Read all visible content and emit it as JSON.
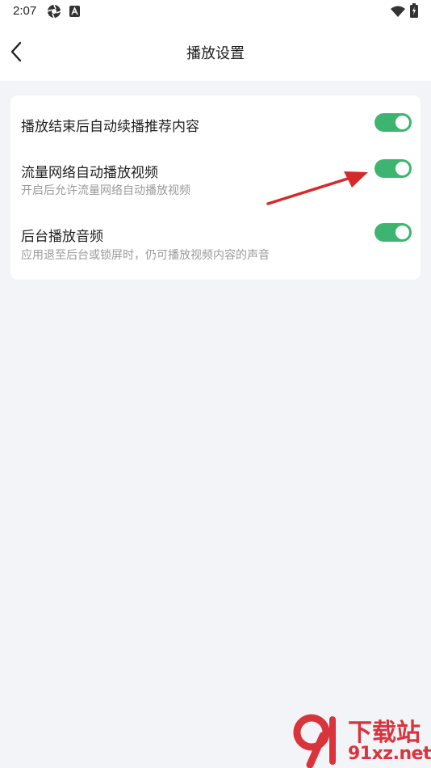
{
  "status_bar": {
    "time": "2:07",
    "icons": [
      "aperture-icon",
      "a-badge-icon",
      "wifi-icon",
      "battery-charging-icon"
    ]
  },
  "header": {
    "title": "播放设置",
    "back_icon": "chevron-left-icon"
  },
  "settings": [
    {
      "title": "播放结束后自动续播推荐内容",
      "description": "",
      "enabled": true
    },
    {
      "title": "流量网络自动播放视频",
      "description": "开启后允许流量网络自动播放视频",
      "enabled": true
    },
    {
      "title": "后台播放音频",
      "description": "应用退至后台或锁屏时，仍可播放视频内容的声音",
      "enabled": true
    }
  ],
  "colors": {
    "toggle_on": "#3db571",
    "page_background": "#f3f4f8",
    "annotation_arrow": "#d42a2a",
    "watermark": "#d9343b"
  },
  "watermark": {
    "line1": "下载站",
    "line2": "91xz.net"
  }
}
